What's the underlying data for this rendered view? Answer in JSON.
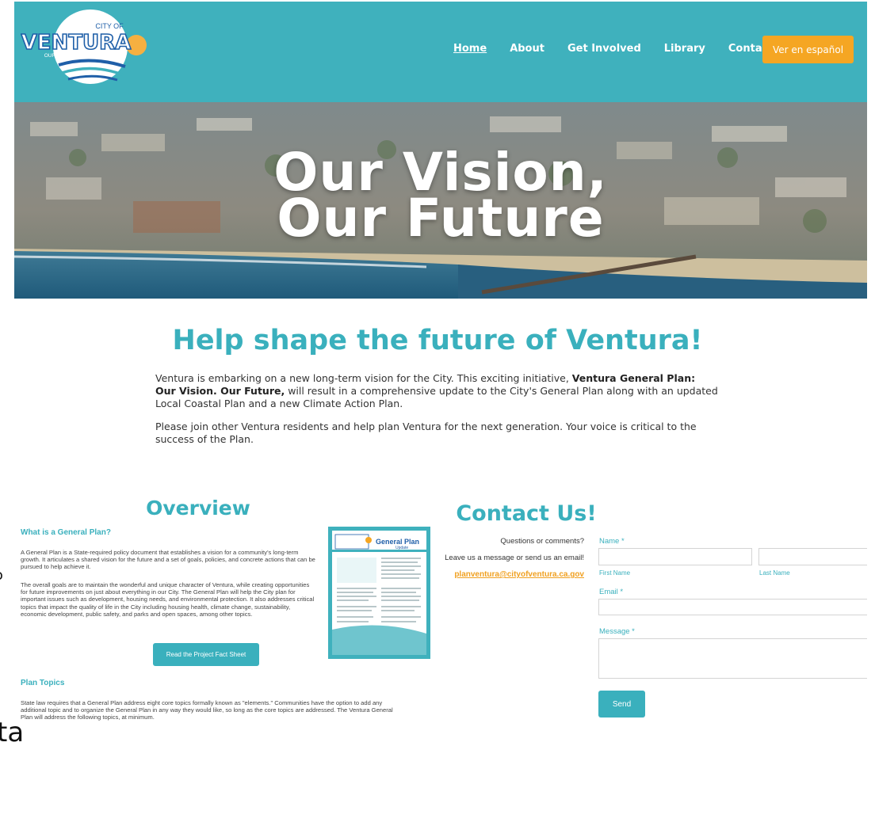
{
  "header": {
    "logo": {
      "line1": "CITY OF",
      "name": "VENTURA",
      "tagline": "OUR VISION, OUR FUTURE"
    },
    "nav": [
      {
        "label": "Home",
        "active": true
      },
      {
        "label": "About",
        "active": false
      },
      {
        "label": "Get Involved",
        "active": false
      },
      {
        "label": "Library",
        "active": false
      },
      {
        "label": "Contact",
        "active": false
      }
    ],
    "language_button": "Ver en español"
  },
  "hero": {
    "title_line1": "Our Vision,",
    "title_line2": "Our Future"
  },
  "intro": {
    "heading": "Help shape the future of Ventura!",
    "p1_start": "Ventura is embarking on a new long-term vision for the City. This exciting initiative, ",
    "p1_bold": "Ventura General Plan: Our Vision. Our Future,",
    "p1_end": " will result in a comprehensive update to the City's General Plan along with an updated Local Coastal Plan and a new Climate Action Plan.",
    "p2": "Please join other Ventura residents and help plan Ventura for the next generation. Your voice is critical to the success of the Plan."
  },
  "overview": {
    "heading": "Overview",
    "q1": "What is a General Plan?",
    "p1": "A General Plan is a State-required policy document that establishes a vision for a community's long-term growth. It articulates a shared vision for the future and a set of goals, policies, and concrete actions that can be pursued to help achieve it.",
    "p2": "The overall goals are to maintain the wonderful and unique character of Ventura, while creating opportunities for future improvements on just about everything in our City. The General Plan will help the City plan for important issues such as development, housing needs, and environmental protection. It also addresses critical topics that impact the quality of life in the City including housing health, climate change, sustainability, economic development, public safety, and parks and open spaces, among other topics.",
    "fact_button": "Read the Project Fact Sheet",
    "fact_sheet_title": "General Plan",
    "fact_sheet_sub": "Update",
    "topics_heading": "Plan Topics",
    "topics_text": "State law requires that a General Plan address eight core topics formally known as \"elements.\" Communities have the option to add any additional topic and to organize the General Plan in any way they would like, so long as the core topics are addressed. The Ventura General Plan will address the following topics, at minimum."
  },
  "contact": {
    "heading": "Contact Us!",
    "line1": "Questions or comments?",
    "line2": "Leave us a message or send us an email!",
    "email": "planventura@cityofventura.ca.gov",
    "name_label": "Name *",
    "first_name": "First Name",
    "last_name": "Last Name",
    "email_label": "Email *",
    "message_label": "Message *",
    "send": "Send"
  },
  "stray": {
    "glyph1": "ɔ",
    "glyph2": "ta"
  },
  "colors": {
    "teal": "#3fb1bd",
    "heading_teal": "#3ab0bd",
    "orange": "#f5a623",
    "link_orange": "#f0a020"
  }
}
